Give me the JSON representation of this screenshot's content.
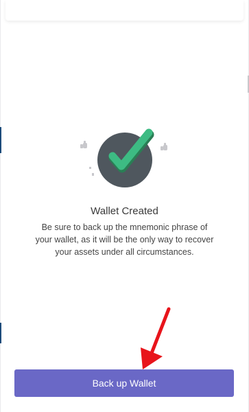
{
  "wallet_created": {
    "title": "Wallet Created",
    "description": "Be sure to back up the mnemonic phrase of your wallet, as it will be the only way to recover your assets under all circumstances."
  },
  "actions": {
    "backup_button_label": "Back up Wallet"
  },
  "colors": {
    "primary_button": "#6a68c6",
    "check_green": "#3dbb83",
    "badge_circle": "#4f575e",
    "annotation_arrow": "#e8141b"
  },
  "icons": {
    "success": "checkmark-icon",
    "decoration": "thumbs-up-icon",
    "annotation": "red-arrow-icon"
  }
}
